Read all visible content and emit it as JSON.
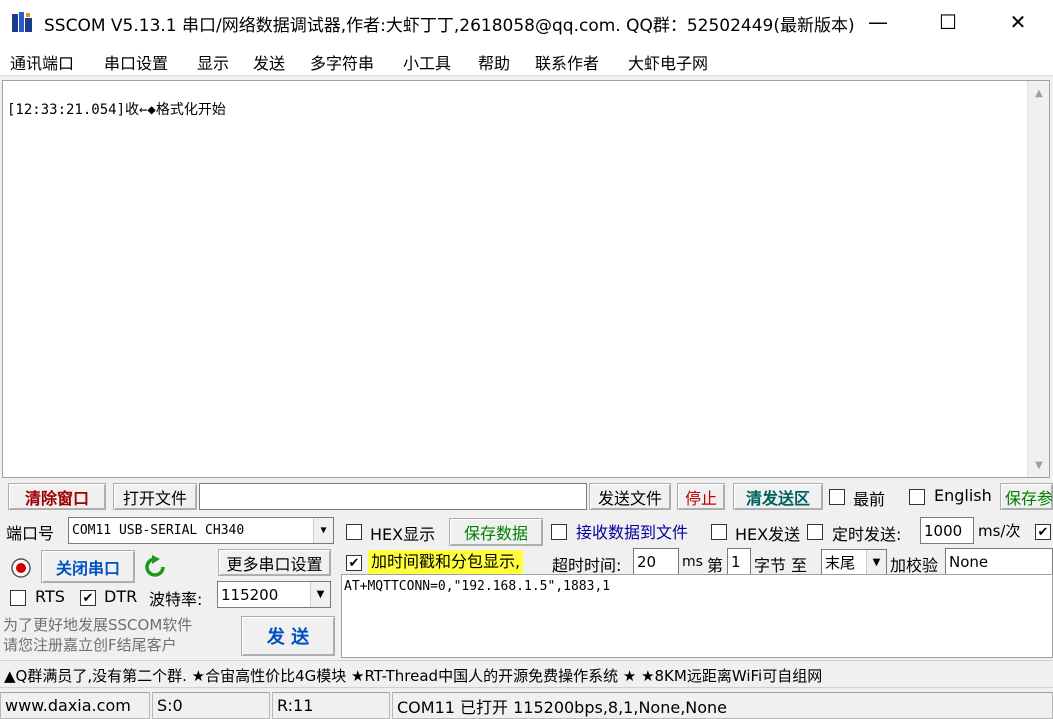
{
  "window": {
    "title": "SSCOM V5.13.1 串口/网络数据调试器,作者:大虾丁丁,2618058@qq.com. QQ群：52502449(最新版本)",
    "minimize": "—",
    "maximize": "☐",
    "close": "✕"
  },
  "menu": [
    "通讯端口",
    "串口设置",
    "显示",
    "发送",
    "多字符串",
    "小工具",
    "帮助",
    "联系作者",
    "大虾电子网"
  ],
  "receive": {
    "log": "[12:33:21.054]收←◆格式化开始"
  },
  "toolbar": {
    "clear_window": "清除窗口",
    "open_file": "打开文件",
    "file_path": "",
    "send_file": "发送文件",
    "stop": "停止",
    "clear_send": "清发送区",
    "last_label": "最前",
    "english_label": "English",
    "save_params": "保存参"
  },
  "port": {
    "port_label": "端口号",
    "port_value": "COM11 USB-SERIAL CH340",
    "close_port": "关闭串口",
    "more_settings": "更多串口设置",
    "rts_label": "RTS",
    "dtr_label": "DTR",
    "baud_label": "波特率:",
    "baud_value": "115200"
  },
  "options": {
    "hex_display": "HEX显示",
    "save_data": "保存数据",
    "recv_to_file": "接收数据到文件",
    "hex_send": "HEX发送",
    "timed_send": "定时发送:",
    "interval": "1000",
    "interval_unit": "ms/次",
    "timestamp": "加时间戳和分包显示,",
    "timeout_label": "超时时间:",
    "timeout_value": "20",
    "ms": "ms",
    "nth": "第",
    "byte_index": "1",
    "byte_label": "字节 至",
    "end_value": "末尾",
    "checksum_label": "加校验",
    "checksum_value": "None"
  },
  "send": {
    "text": "AT+MQTTCONN=0,\"192.168.1.5\",1883,1",
    "button": "发 送",
    "promo": [
      "为了更好地发展SSCOM软件",
      "请您注册嘉立创F结尾客户"
    ]
  },
  "marquee": "▲Q群满员了,没有第二个群. ★合宙高性价比4G模块 ★RT-Thread中国人的开源免费操作系统 ★ ★8KM远距离WiFi可自组网",
  "status": {
    "website": "www.daxia.com",
    "sent": "S:0",
    "received": "R:11",
    "port_state": "COM11 已打开  115200bps,8,1,None,None"
  }
}
